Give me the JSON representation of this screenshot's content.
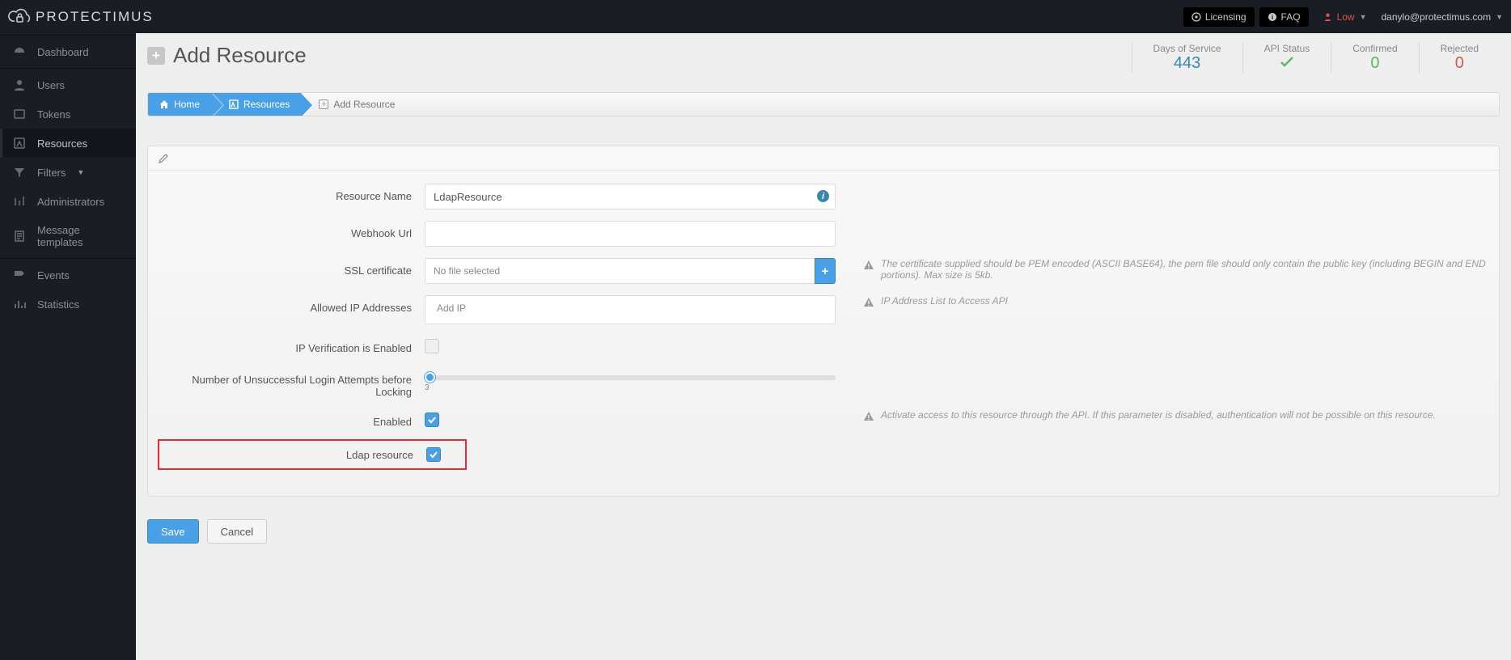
{
  "brand": "PROTECTIMUS",
  "topbar": {
    "licensing": "Licensing",
    "faq": "FAQ",
    "low": "Low",
    "user": "danylo@protectimus.com"
  },
  "sidebar": {
    "items": [
      {
        "label": "Dashboard"
      },
      {
        "label": "Users"
      },
      {
        "label": "Tokens"
      },
      {
        "label": "Resources"
      },
      {
        "label": "Filters"
      },
      {
        "label": "Administrators"
      },
      {
        "label": "Message templates"
      },
      {
        "label": "Events"
      },
      {
        "label": "Statistics"
      }
    ]
  },
  "header": {
    "page_title": "Add Resource",
    "stats": {
      "days_label": "Days of Service",
      "days_value": "443",
      "api_label": "API Status",
      "confirmed_label": "Confirmed",
      "confirmed_value": "0",
      "rejected_label": "Rejected",
      "rejected_value": "0"
    }
  },
  "breadcrumb": {
    "home": "Home",
    "resources": "Resources",
    "current": "Add Resource"
  },
  "form": {
    "resource_name_label": "Resource Name",
    "resource_name_value": "LdapResource",
    "webhook_label": "Webhook Url",
    "webhook_value": "",
    "ssl_label": "SSL certificate",
    "ssl_placeholder": "No file selected",
    "ssl_hint": "The certificate supplied should be PEM encoded (ASCII BASE64), the pem file should only contain the public key (including BEGIN and END portions). Max size is 5kb.",
    "ip_label": "Allowed IP Addresses",
    "ip_placeholder": "Add IP",
    "ip_hint": "IP Address List to Access API",
    "ipverify_label": "IP Verification is Enabled",
    "attempts_label": "Number of Unsuccessful Login Attempts before Locking",
    "attempts_value": "3",
    "enabled_label": "Enabled",
    "enabled_hint": "Activate access to this resource through the API. If this parameter is disabled, authentication will not be possible on this resource.",
    "ldap_label": "Ldap resource"
  },
  "buttons": {
    "save": "Save",
    "cancel": "Cancel"
  }
}
